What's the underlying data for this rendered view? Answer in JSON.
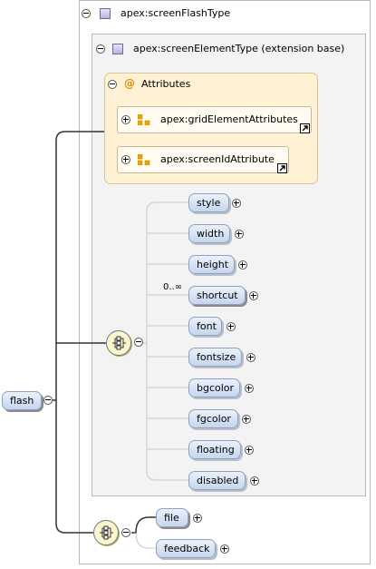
{
  "types": {
    "outer_label": "apex:screenFlashType",
    "extension_label": "apex:screenElementType (extension base)"
  },
  "attributes": {
    "label": "Attributes",
    "at_symbol": "@",
    "groups": [
      "apex:gridElementAttributes",
      "apex:screenIdAttribute"
    ]
  },
  "root": {
    "label": "flash"
  },
  "sequence1": {
    "cardinality": "0..∞",
    "elements": [
      "style",
      "width",
      "height",
      "shortcut",
      "font",
      "fontsize",
      "bgcolor",
      "fgcolor",
      "floating",
      "disabled"
    ]
  },
  "sequence2": {
    "elements": [
      "file",
      "feedback"
    ]
  },
  "colors": {
    "pill_fill": "#c6d6ee",
    "attribute_box": "#fff2d4",
    "compositor_fill": "#fbf6cc",
    "at_symbol": "#e08a00",
    "group_icon": "#f0a800"
  }
}
